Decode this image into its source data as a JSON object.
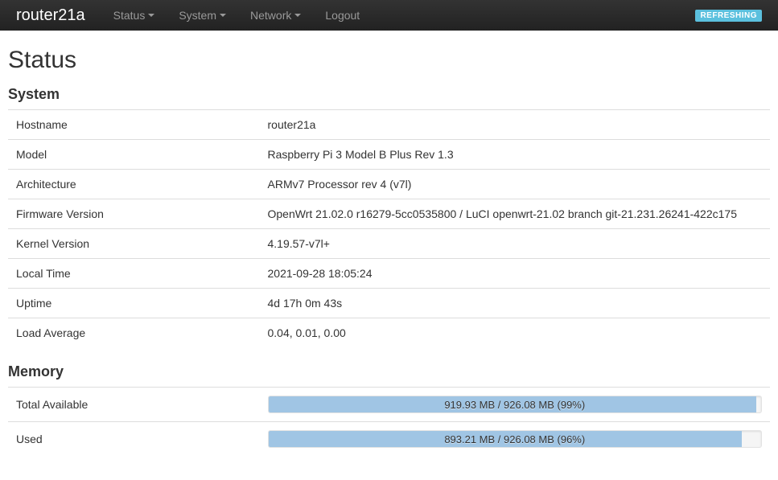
{
  "navbar": {
    "brand": "router21a",
    "items": [
      {
        "label": "Status",
        "dropdown": true
      },
      {
        "label": "System",
        "dropdown": true
      },
      {
        "label": "Network",
        "dropdown": true
      },
      {
        "label": "Logout",
        "dropdown": false
      }
    ],
    "refreshing_badge": "REFRESHING"
  },
  "page_title": "Status",
  "sections": {
    "system": {
      "heading": "System",
      "rows": [
        {
          "label": "Hostname",
          "value": "router21a"
        },
        {
          "label": "Model",
          "value": "Raspberry Pi 3 Model B Plus Rev 1.3"
        },
        {
          "label": "Architecture",
          "value": "ARMv7 Processor rev 4 (v7l)"
        },
        {
          "label": "Firmware Version",
          "value": "OpenWrt 21.02.0 r16279-5cc0535800 / LuCI openwrt-21.02 branch git-21.231.26241-422c175"
        },
        {
          "label": "Kernel Version",
          "value": "4.19.57-v7l+"
        },
        {
          "label": "Local Time",
          "value": "2021-09-28 18:05:24"
        },
        {
          "label": "Uptime",
          "value": "4d 17h 0m 43s"
        },
        {
          "label": "Load Average",
          "value": "0.04, 0.01, 0.00"
        }
      ]
    },
    "memory": {
      "heading": "Memory",
      "rows": [
        {
          "label": "Total Available",
          "text": "919.93 MB / 926.08 MB (99%)",
          "percent": 99
        },
        {
          "label": "Used",
          "text": "893.21 MB / 926.08 MB (96%)",
          "percent": 96
        }
      ]
    }
  }
}
